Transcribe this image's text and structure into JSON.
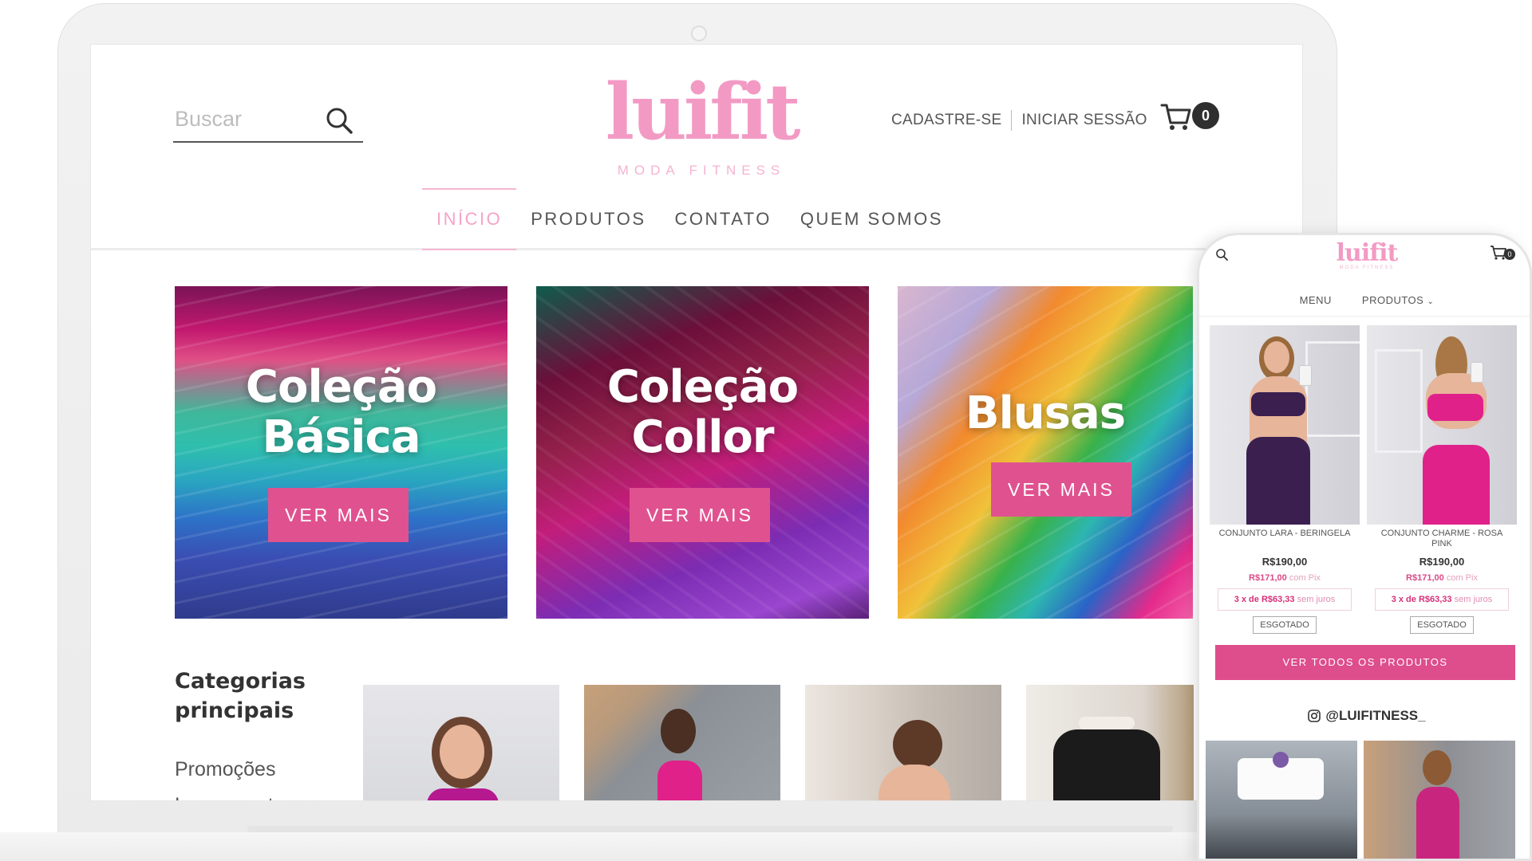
{
  "site": {
    "logo_word": "luifit",
    "logo_tagline": "MODA FITNESS"
  },
  "header": {
    "search_placeholder": "Buscar",
    "register_label": "CADASTRE-SE",
    "login_label": "INICIAR SESSÃO",
    "cart_count": "0"
  },
  "nav": {
    "items": [
      {
        "label": "INÍCIO",
        "active": true
      },
      {
        "label": "PRODUTOS",
        "active": false
      },
      {
        "label": "CONTATO",
        "active": false
      },
      {
        "label": "QUEM SOMOS",
        "active": false
      }
    ]
  },
  "banners": [
    {
      "title_line1": "Coleção",
      "title_line2": "Básica",
      "button": "VER MAIS"
    },
    {
      "title_line1": "Coleção",
      "title_line2": "Collor",
      "button": "VER MAIS"
    },
    {
      "title_line1": "Blusas",
      "button": "VER MAIS"
    }
  ],
  "categories": {
    "heading": "Categorias principais",
    "links": [
      "Promoções",
      "Lançamentos"
    ]
  },
  "mobile": {
    "nav": {
      "menu": "MENU",
      "produtos": "PRODUTOS"
    },
    "cart_count": "0",
    "products": [
      {
        "name": "CONJUNTO LARA - BERINGELA",
        "price": "R$190,00",
        "pix_price": "R$171,00",
        "pix_suffix": "com Pix",
        "installments_prefix": "3 x de",
        "installment_value": "R$63,33",
        "installments_suffix": "sem juros",
        "status": "ESGOTADO",
        "outfit_color": "#3a1f4f"
      },
      {
        "name": "CONJUNTO CHARME - ROSA PINK",
        "price": "R$190,00",
        "pix_price": "R$171,00",
        "pix_suffix": "com Pix",
        "installments_prefix": "3 x de",
        "installment_value": "R$63,33",
        "installments_suffix": "sem juros",
        "status": "ESGOTADO",
        "outfit_color": "#e0218a"
      }
    ],
    "view_all_button": "VER TODOS OS PRODUTOS",
    "instagram_handle": "@LUIFITNESS_"
  },
  "colors": {
    "brand_pink": "#f29ac4",
    "button_pink": "#e0528f",
    "text_dark": "#333333"
  }
}
